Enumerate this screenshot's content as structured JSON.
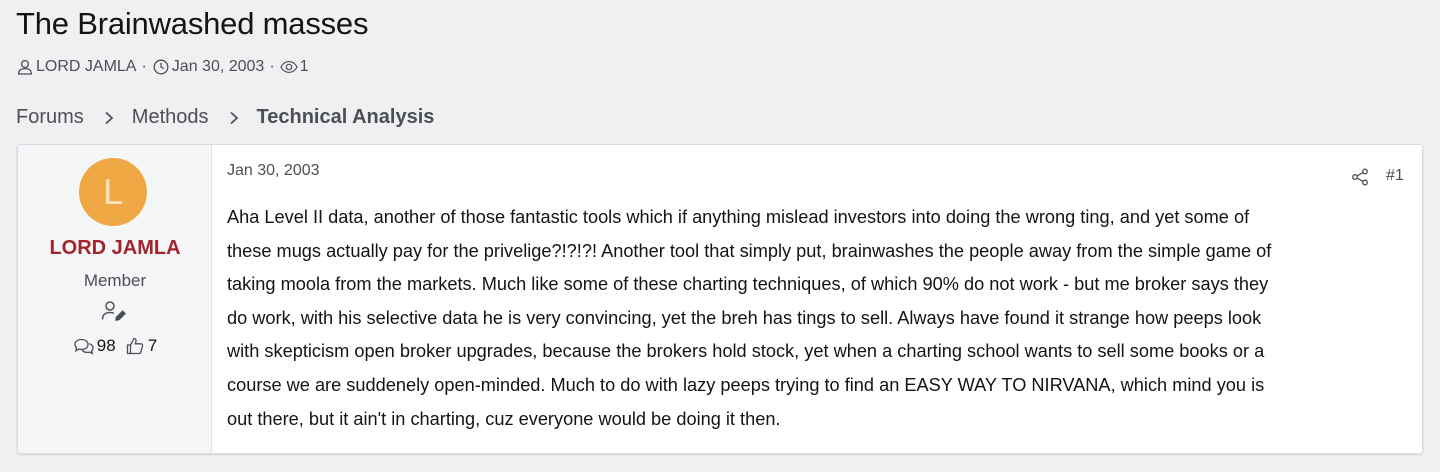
{
  "thread": {
    "title": "The Brainwashed masses",
    "author": "LORD JAMLA",
    "sep": "·",
    "date": "Jan 30, 2003",
    "views": "1"
  },
  "breadcrumb": {
    "items": [
      "Forums",
      "Methods",
      "Technical Analysis"
    ]
  },
  "post": {
    "user": {
      "avatar_letter": "L",
      "name": "LORD JAMLA",
      "title": "Member",
      "messages": "98",
      "reactions": "7"
    },
    "date": "Jan 30, 2003",
    "number": "#1",
    "lines": [
      "Aha Level II data, another of those fantastic tools which if anything mislead investors into doing the wrong ting, and yet some of",
      "these mugs actually pay for the privelige?!?!?! Another tool that simply put, brainwashes the people away from the simple game of",
      "taking moola from the markets. Much like some of these charting techniques, of which 90% do not work - but me broker says they",
      "do work, with his selective data he is very convincing, yet the breh has tings to sell. Always have found it strange how peeps look",
      "with skepticism open broker upgrades, because the brokers hold stock, yet when a charting school wants to sell some books or a",
      "course we are suddenely open-minded. Much to do with lazy peeps trying to find an EASY WAY TO NIRVANA, which mind you is",
      "out there, but it ain't in charting, cuz everyone would be doing it then."
    ]
  },
  "colors": {
    "background": "#eff0f2",
    "username": "#a0252c",
    "avatar": "#f0a845",
    "muted_text": "#4c4f54"
  },
  "icons": {
    "author": "user-icon",
    "date": "clock-icon",
    "views": "eye-icon",
    "separator": "chevron-right-icon",
    "user_action": "user-edit-icon",
    "messages": "comments-icon",
    "reactions": "thumbs-up-icon",
    "share": "share-icon"
  }
}
